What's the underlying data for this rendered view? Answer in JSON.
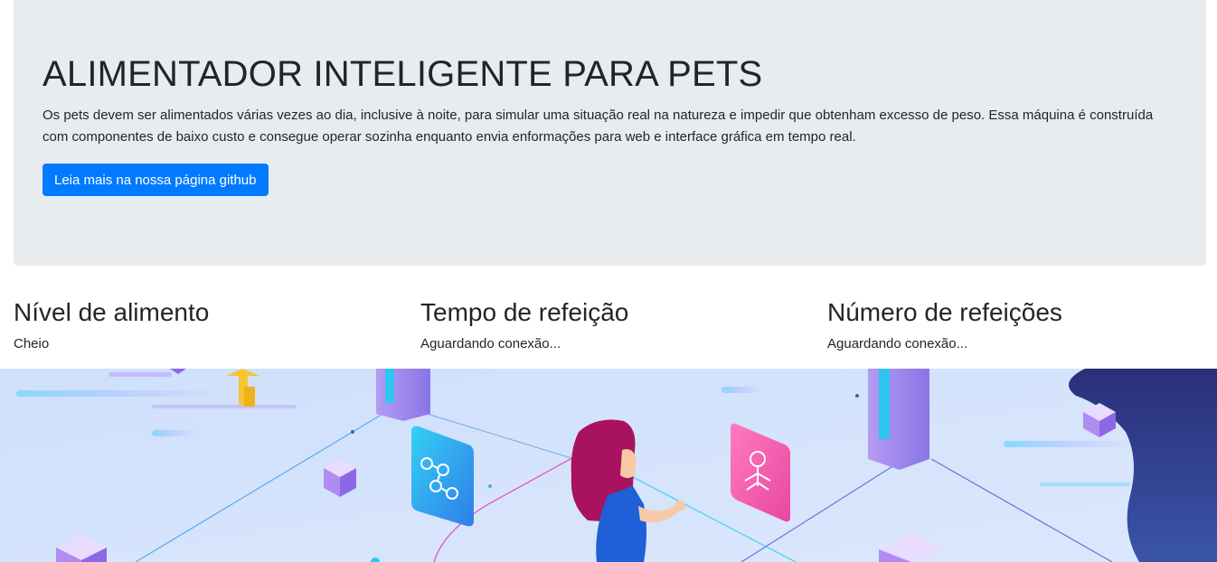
{
  "hero": {
    "title": "ALIMENTADOR INTELIGENTE PARA PETS",
    "description": "Os pets devem ser alimentados várias vezes ao dia, inclusive à noite, para simular uma situação real na natureza e impedir que obtenham excesso de peso. Essa máquina é construída com componentes de baixo custo e consegue operar sozinha enquanto envia enformações para web e interface gráfica em tempo real.",
    "button_label": "Leia mais na nossa página github"
  },
  "stats": [
    {
      "title": "Nível de alimento",
      "value": "Cheio"
    },
    {
      "title": "Tempo de refeição",
      "value": "Aguardando conexão..."
    },
    {
      "title": "Número de refeições",
      "value": "Aguardando conexão..."
    }
  ],
  "colors": {
    "primary": "#007bff",
    "jumbotron_bg": "#e9ecef",
    "text": "#212529",
    "illustration_bg": "#cfe0fb"
  },
  "illustration": {
    "icons": [
      "cube-icon",
      "server-tower-icon",
      "circuit-card-icon",
      "arrow-up-icon",
      "woman-figure-icon",
      "blob-shape-icon"
    ]
  }
}
